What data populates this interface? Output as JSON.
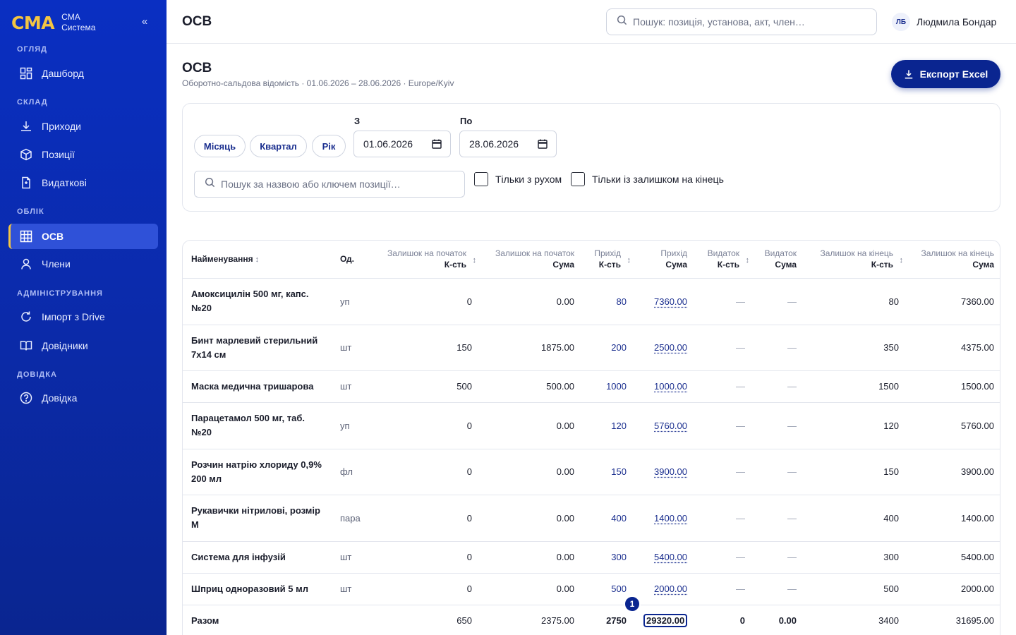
{
  "brand": {
    "logo": "CMA",
    "line1": "CMA",
    "line2": "Система",
    "collapse": "«"
  },
  "nav": {
    "overview": "ОГЛЯД",
    "dashboard": "Дашборд",
    "warehouse": "СКЛАД",
    "receipts": "Приходи",
    "items": "Позиції",
    "expenses": "Видаткові",
    "accounting": "ОБЛІК",
    "osv": "ОСВ",
    "members": "Члени",
    "admin": "АДМІНІСТРУВАННЯ",
    "import": "Імпорт з Drive",
    "refs": "Довідники",
    "help_section": "ДОВІДКА",
    "help": "Довідка"
  },
  "header": {
    "title": "ОСВ",
    "search_placeholder": "Пошук: позиція, установа, акт, член…",
    "user_initials": "ЛБ",
    "user_name": "Людмила Бондар"
  },
  "page": {
    "title": "ОСВ",
    "subtitle": "Оборотно-сальдова відомість · 01.06.2026 – 28.06.2026 · Europe/Kyiv",
    "export_label": "Експорт Excel"
  },
  "filters": {
    "month": "Місяць",
    "quarter": "Квартал",
    "year": "Рік",
    "from_label": "З",
    "from_value": "01.06.2026",
    "to_label": "По",
    "to_value": "28.06.2026",
    "search_placeholder": "Пошук за назвою або ключем позиції…",
    "only_movement": "Тільки з рухом",
    "only_balance": "Тільки із залишком на кінець"
  },
  "table": {
    "headers": {
      "name": "Найменування",
      "unit": "Од.",
      "open_qty_1": "Залишок на початок",
      "open_qty_2": "К-сть",
      "open_sum_1": "Залишок на початок",
      "open_sum_2": "Сума",
      "in_qty_1": "Прихід",
      "in_qty_2": "К-сть",
      "in_sum_1": "Прихід",
      "in_sum_2": "Сума",
      "out_qty_1": "Видаток",
      "out_qty_2": "К-сть",
      "out_sum_1": "Видаток",
      "out_sum_2": "Сума",
      "close_qty_1": "Залишок на кінець",
      "close_qty_2": "К-сть",
      "close_sum_1": "Залишок на кінець",
      "close_sum_2": "Сума"
    },
    "rows": [
      {
        "name": "Амоксицилін 500 мг, капс. №20",
        "unit": "уп",
        "open_qty": "0",
        "open_sum": "0.00",
        "in_qty": "80",
        "in_sum": "7360.00",
        "out_qty": "—",
        "out_sum": "—",
        "close_qty": "80",
        "close_sum": "7360.00"
      },
      {
        "name": "Бинт марлевий стерильний 7х14 см",
        "unit": "шт",
        "open_qty": "150",
        "open_sum": "1875.00",
        "in_qty": "200",
        "in_sum": "2500.00",
        "out_qty": "—",
        "out_sum": "—",
        "close_qty": "350",
        "close_sum": "4375.00"
      },
      {
        "name": "Маска медична тришарова",
        "unit": "шт",
        "open_qty": "500",
        "open_sum": "500.00",
        "in_qty": "1000",
        "in_sum": "1000.00",
        "out_qty": "—",
        "out_sum": "—",
        "close_qty": "1500",
        "close_sum": "1500.00"
      },
      {
        "name": "Парацетамол 500 мг, таб. №20",
        "unit": "уп",
        "open_qty": "0",
        "open_sum": "0.00",
        "in_qty": "120",
        "in_sum": "5760.00",
        "out_qty": "—",
        "out_sum": "—",
        "close_qty": "120",
        "close_sum": "5760.00"
      },
      {
        "name": "Розчин натрію хлориду 0,9% 200 мл",
        "unit": "фл",
        "open_qty": "0",
        "open_sum": "0.00",
        "in_qty": "150",
        "in_sum": "3900.00",
        "out_qty": "—",
        "out_sum": "—",
        "close_qty": "150",
        "close_sum": "3900.00"
      },
      {
        "name": "Рукавички нітрилові, розмір M",
        "unit": "пара",
        "open_qty": "0",
        "open_sum": "0.00",
        "in_qty": "400",
        "in_sum": "1400.00",
        "out_qty": "—",
        "out_sum": "—",
        "close_qty": "400",
        "close_sum": "1400.00"
      },
      {
        "name": "Система для інфузій",
        "unit": "шт",
        "open_qty": "0",
        "open_sum": "0.00",
        "in_qty": "300",
        "in_sum": "5400.00",
        "out_qty": "—",
        "out_sum": "—",
        "close_qty": "300",
        "close_sum": "5400.00"
      },
      {
        "name": "Шприц одноразовий 5 мл",
        "unit": "шт",
        "open_qty": "0",
        "open_sum": "0.00",
        "in_qty": "500",
        "in_sum": "2000.00",
        "out_qty": "—",
        "out_sum": "—",
        "close_qty": "500",
        "close_sum": "2000.00"
      }
    ],
    "total": {
      "label": "Разом",
      "open_qty": "650",
      "open_sum": "2375.00",
      "in_qty": "2750",
      "in_sum": "29320.00",
      "out_qty": "0",
      "out_sum": "0.00",
      "close_qty": "3400",
      "close_sum": "31695.00"
    }
  },
  "badge": "1"
}
